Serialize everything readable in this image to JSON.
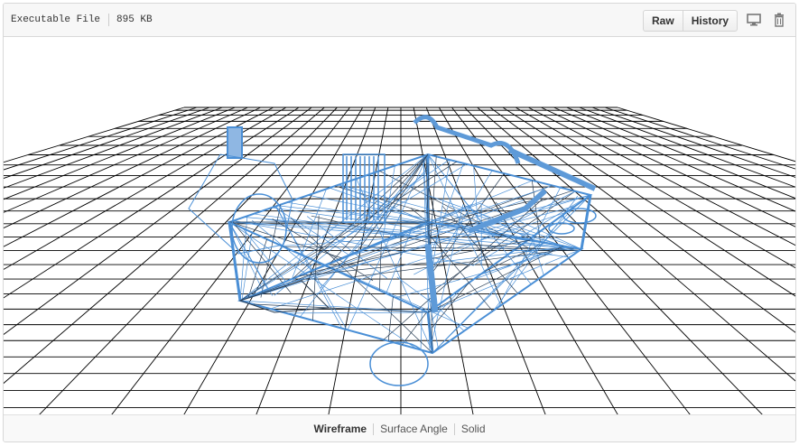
{
  "file": {
    "type_label": "Executable File",
    "size_label": "895 KB"
  },
  "actions": {
    "raw_label": "Raw",
    "history_label": "History"
  },
  "icons": {
    "display": "desktop-icon",
    "delete": "trash-icon"
  },
  "viewer": {
    "model": "3d-wireframe-model",
    "grid_color": "#000000",
    "model_color": "#4a8fd6"
  },
  "modes": [
    {
      "label": "Wireframe",
      "active": true
    },
    {
      "label": "Surface Angle",
      "active": false
    },
    {
      "label": "Solid",
      "active": false
    }
  ]
}
